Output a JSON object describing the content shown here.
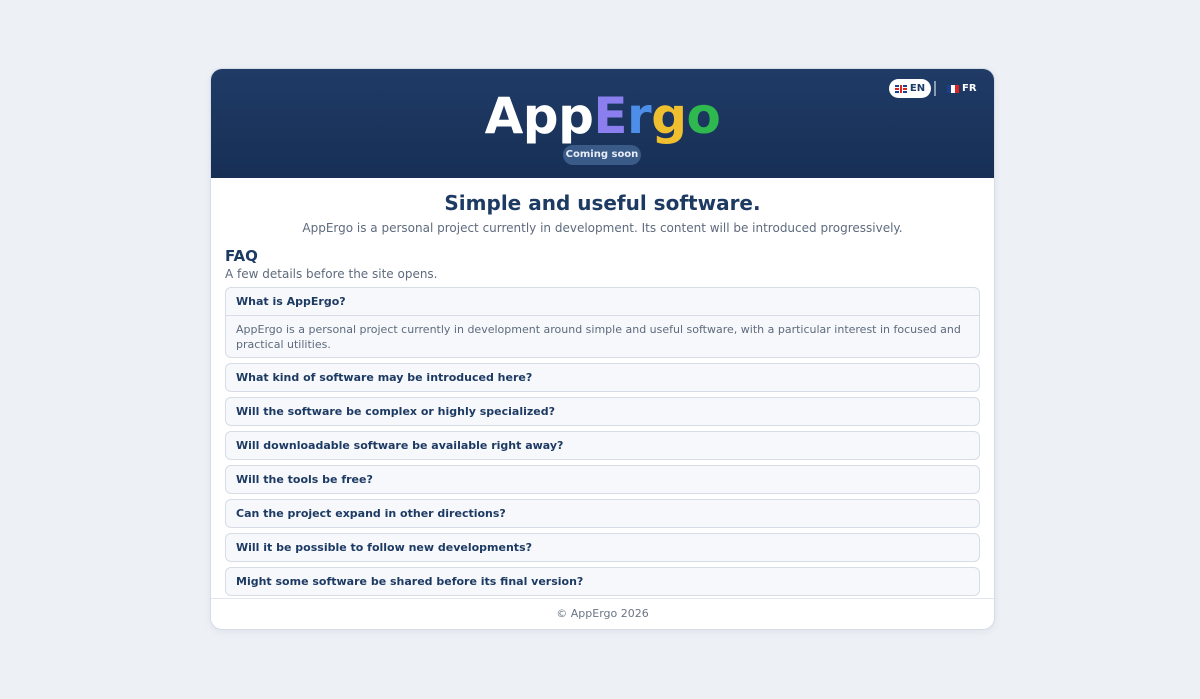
{
  "header": {
    "brand": {
      "letters": [
        {
          "text": "App",
          "color": "#ffffff"
        },
        {
          "text": "E",
          "color": "#8b7ff0"
        },
        {
          "text": "r",
          "color": "#4d8fe8"
        },
        {
          "text": "g",
          "color": "#f0bf30"
        },
        {
          "text": "o",
          "color": "#2eb84f"
        }
      ]
    },
    "badge": "Coming soon",
    "languages": [
      {
        "code": "EN",
        "flag": "uk-flag-icon",
        "active": true
      },
      {
        "code": "FR",
        "flag": "fr-flag-icon",
        "active": false
      }
    ]
  },
  "main": {
    "headline": "Simple and useful software.",
    "intro": "AppErgo is a personal project currently in development. Its content will be introduced progressively."
  },
  "faq": {
    "title": "FAQ",
    "subtitle": "A few details before the site opens.",
    "items": [
      {
        "question": "What is AppErgo?",
        "answer": "AppErgo is a personal project currently in development around simple and useful software, with a particular interest in focused and practical utilities.",
        "expanded": true
      },
      {
        "question": "What kind of software may be introduced here?",
        "expanded": false
      },
      {
        "question": "Will the software be complex or highly specialized?",
        "expanded": false
      },
      {
        "question": "Will downloadable software be available right away?",
        "expanded": false
      },
      {
        "question": "Will the tools be free?",
        "expanded": false
      },
      {
        "question": "Can the project expand in other directions?",
        "expanded": false
      },
      {
        "question": "Will it be possible to follow new developments?",
        "expanded": false
      },
      {
        "question": "Might some software be shared before its final version?",
        "expanded": false
      }
    ]
  },
  "footer": {
    "copyright": "© AppErgo 2026"
  },
  "colors": {
    "page_bg": "#edf1f6",
    "header_bg": "#1f3b66",
    "navy_text": "#1d3a63",
    "muted_text": "#5e6b7d"
  }
}
